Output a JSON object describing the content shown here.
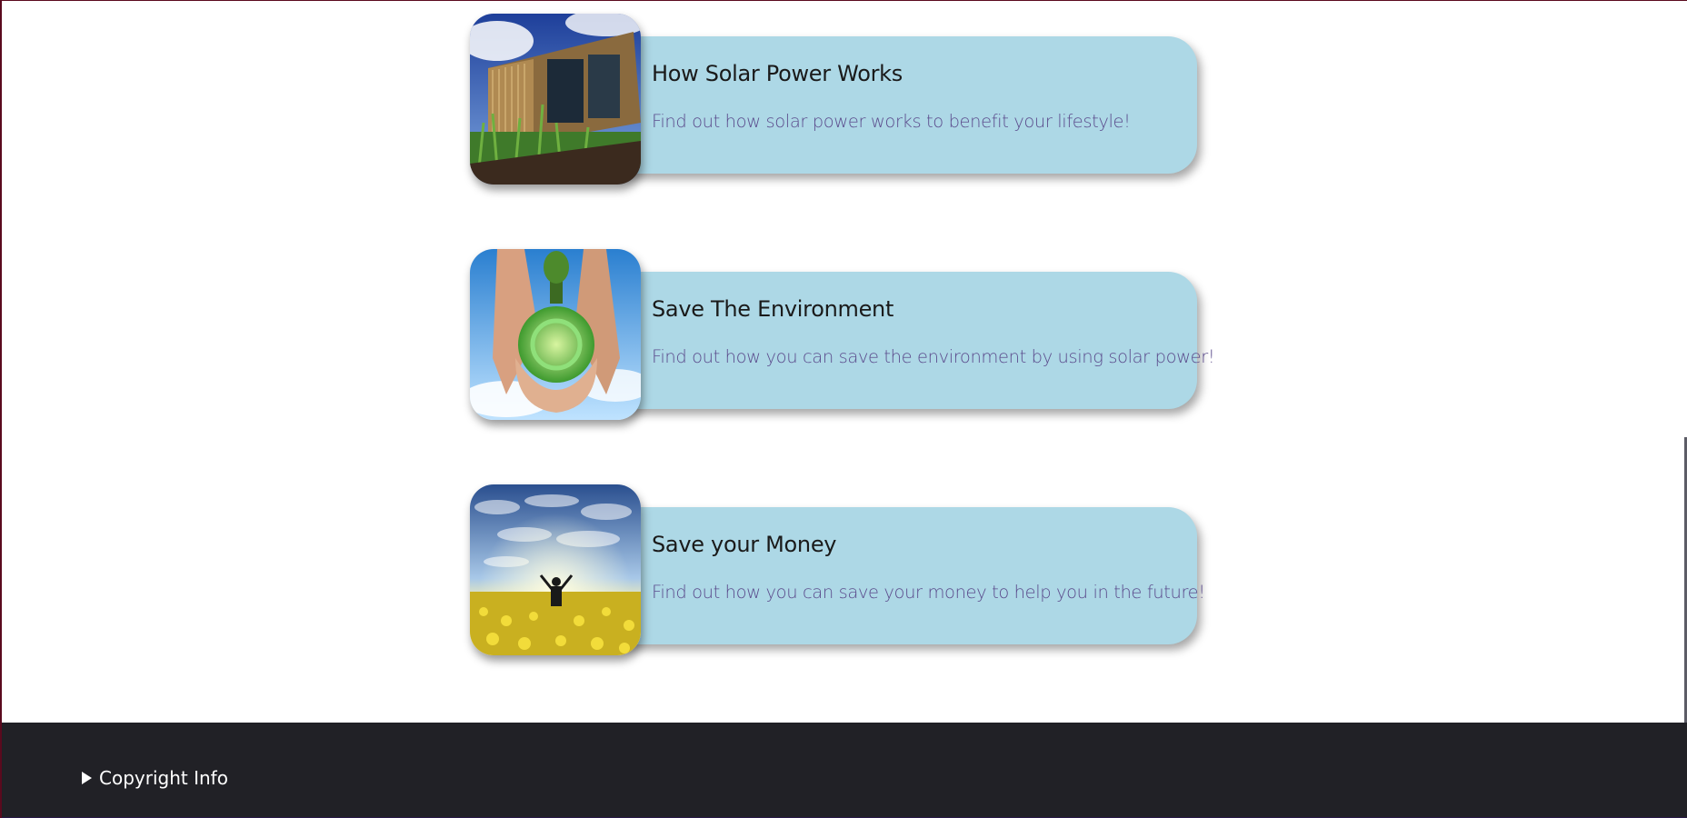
{
  "cards": [
    {
      "title": "How Solar Power Works",
      "description": "Find out how solar power works to benefit your lifestyle!",
      "image_icon": "solar-house-image"
    },
    {
      "title": "Save The Environment",
      "description": "Find out how you can save the environment by using solar power!",
      "image_icon": "hands-globe-image"
    },
    {
      "title": "Save your Money",
      "description": "Find out how you can save your money to help you in the future!",
      "image_icon": "field-sunrise-image"
    }
  ],
  "footer": {
    "copyright_label": "Copyright Info",
    "toggle_icon": "triangle-right-icon",
    "background": "#212126"
  },
  "colors": {
    "card_background": "#add8e6",
    "title_text": "#1a1a1a",
    "description_text": "#5b4b8c"
  }
}
